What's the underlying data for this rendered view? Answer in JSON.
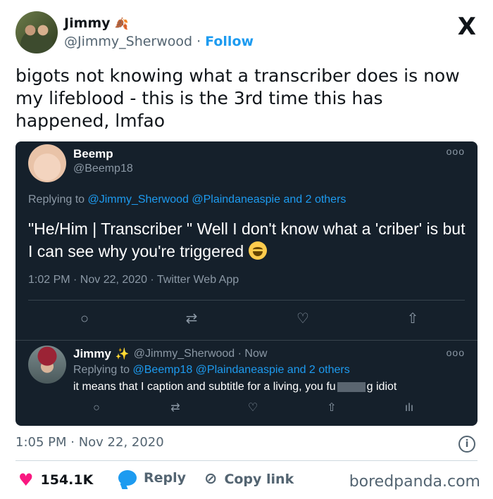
{
  "tweet": {
    "author_name": "Jimmy",
    "author_emoji": "🍂",
    "author_handle": "@Jimmy_Sherwood",
    "separator": "·",
    "follow_label": "Follow",
    "x_logo": "X",
    "text": "bigots not knowing what a transcriber does is now\nmy lifeblood - this is the 3rd time this has\nhappened, lmfao",
    "timestamp": "1:05 PM · Nov 22, 2020",
    "info_icon": "i"
  },
  "embedded": {
    "original": {
      "name": "Beemp",
      "handle": "@Beemp18",
      "more": "ooo",
      "replying_prefix": "Replying to",
      "replying_links": "@Jimmy_Sherwood @Plaindaneaspie and 2 others",
      "body": "\"He/Him | Transcriber \" Well I don't know what a 'criber' is but I can see why you're triggered",
      "meta": "1:02 PM · Nov 22, 2020 · Twitter Web App",
      "actions": {
        "reply": "○",
        "retweet": "⇄",
        "like": "♡",
        "share": "⇧"
      }
    },
    "reply": {
      "name": "Jimmy",
      "sparkle": "✨",
      "handle_time": "@Jimmy_Sherwood · Now",
      "more": "ooo",
      "replying_prefix": "Replying to",
      "replying_links": "@Beemp18 @Plaindaneaspie and 2 others",
      "body_start": "it means that I caption and subtitle for a living, you fu",
      "body_end": "g idiot",
      "actions": {
        "reply": "○",
        "retweet": "⇄",
        "like": "♡",
        "share": "⇧",
        "stats": "ılı"
      }
    }
  },
  "footer": {
    "likes": "154.1K",
    "reply_label": "Reply",
    "copy_link_label": "Copy link",
    "link_icon": "⊘"
  },
  "watermark": "boredpanda.com",
  "colors": {
    "accent": "#1d9bf0",
    "like": "#f91880",
    "embed_bg": "#15202b"
  }
}
